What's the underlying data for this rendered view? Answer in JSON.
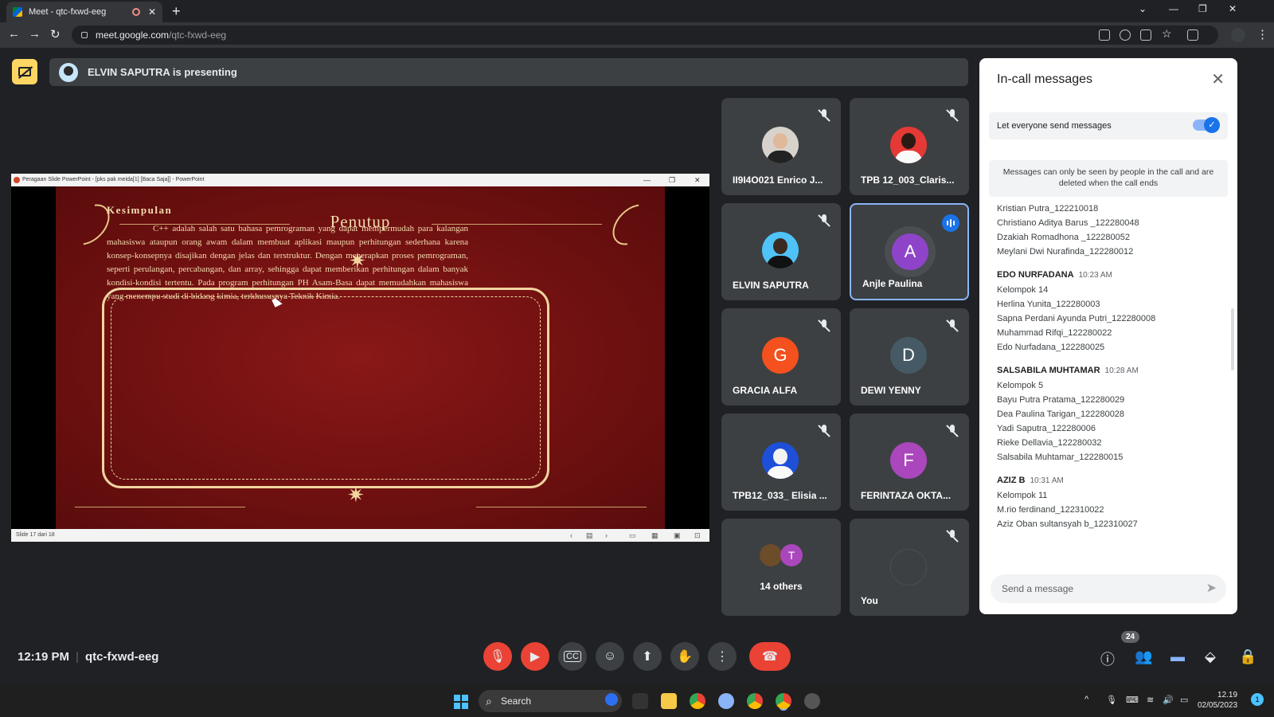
{
  "browser": {
    "tab_title": "Meet - qtc-fxwd-eeg",
    "tab_close": "✕",
    "new_tab": "+",
    "url_host": "meet.google.com",
    "url_path": "/qtc-fxwd-eeg",
    "back": "←",
    "forward": "→",
    "reload": "↻",
    "menu": "⋮",
    "min": "—",
    "restore": "❐",
    "close": "✕",
    "tab_search": "⌄"
  },
  "presenting": {
    "text": "ELVIN SAPUTRA is presenting"
  },
  "slide": {
    "window_title": "Peragaan Slide PowerPoint - [pks pak meida[1] [Baca Saja]] - PowerPoint",
    "heading": "Penutup",
    "box_title": "Kesimpulan",
    "body": "C++ adalah salah satu bahasa pemrograman yang dapat mempermudah para kalangan mahasiswa ataupun orang awam dalam membuat aplikasi maupun perhitungan sederhana karena konsep-konsepnya disajikan dengan jelas dan terstruktur. Dengan menerapkan proses pemrograman, seperti perulangan, percabangan, dan array, sehingga dapat memberikan perhitungan dalam banyak kondisi-kondisi tertentu. Pada program perhitungan PH Asam-Basa dapat memudahkan mahasiswa yang menempu studi di bidang kimia, terkhususnya Teknik Kimia.",
    "status": "Slide 17 dari 18"
  },
  "participants": [
    {
      "name": "II9I4O021 Enrico J...",
      "type": "photo",
      "color": "#d7d2cc"
    },
    {
      "name": "TPB 12_003_Claris...",
      "type": "photo",
      "color": "#e53935"
    },
    {
      "name": "ELVIN SAPUTRA",
      "type": "photo",
      "color": "#4fc3f7"
    },
    {
      "name": "Anjle Paulina",
      "type": "letter",
      "letter": "A",
      "color": "#8e44c8"
    },
    {
      "name": "GRACIA ALFA",
      "type": "letter",
      "letter": "G",
      "color": "#f4511e"
    },
    {
      "name": "DEWI YENNY",
      "type": "letter",
      "letter": "D",
      "color": "#455a64"
    },
    {
      "name": "TPB12_033_ Elisia ...",
      "type": "photo",
      "color": "#1e4fd8"
    },
    {
      "name": "FERINTAZA OKTA...",
      "type": "letter",
      "letter": "F",
      "color": "#ab47bc"
    },
    {
      "name": "14 others",
      "type": "others",
      "letter": "T",
      "color": "#ab47bc"
    },
    {
      "name": "You",
      "type": "you"
    }
  ],
  "chat": {
    "title": "In-call messages",
    "close": "✕",
    "setting_label": "Let everyone send messages",
    "notice": "Messages can only be seen by people in the call and are deleted when the call ends",
    "groups": [
      {
        "sender": "",
        "time": "",
        "lines": [
          "Kristian Putra_122210018",
          "Christiano Aditya Barus _122280048",
          "Dzakiah Romadhona _122280052",
          "Meylani Dwi Nurafinda_122280012"
        ]
      },
      {
        "sender": "EDO NURFADANA",
        "time": "10:23 AM",
        "lines": [
          "Kelompok 14",
          "Herlina Yunita_122280003",
          "Sapna Perdani Ayunda Putri_122280008",
          "Muhammad Rifqi_122280022",
          "Edo Nurfadana_122280025"
        ]
      },
      {
        "sender": "SALSABILA MUHTAMAR",
        "time": "10:28 AM",
        "lines": [
          "Kelompok 5",
          "Bayu Putra Pratama_122280029",
          "Dea Paulina Tarigan_122280028",
          "Yadi Saputra_122280006",
          "Rieke Dellavia_122280032",
          "Salsabila Muhtamar_122280015"
        ]
      },
      {
        "sender": "AZIZ B",
        "time": "10:31 AM",
        "lines": [
          "Kelompok 11",
          "M.rio ferdinand_122310022",
          "Aziz Oban sultansyah b_122310027"
        ]
      }
    ],
    "placeholder": "Send a message",
    "send": "➤"
  },
  "bottom": {
    "time": "12:19 PM",
    "code": "qtc-fxwd-eeg",
    "people_count": "24"
  },
  "taskbar": {
    "search": "Search",
    "time": "12.19",
    "date": "02/05/2023",
    "notif": "1"
  }
}
